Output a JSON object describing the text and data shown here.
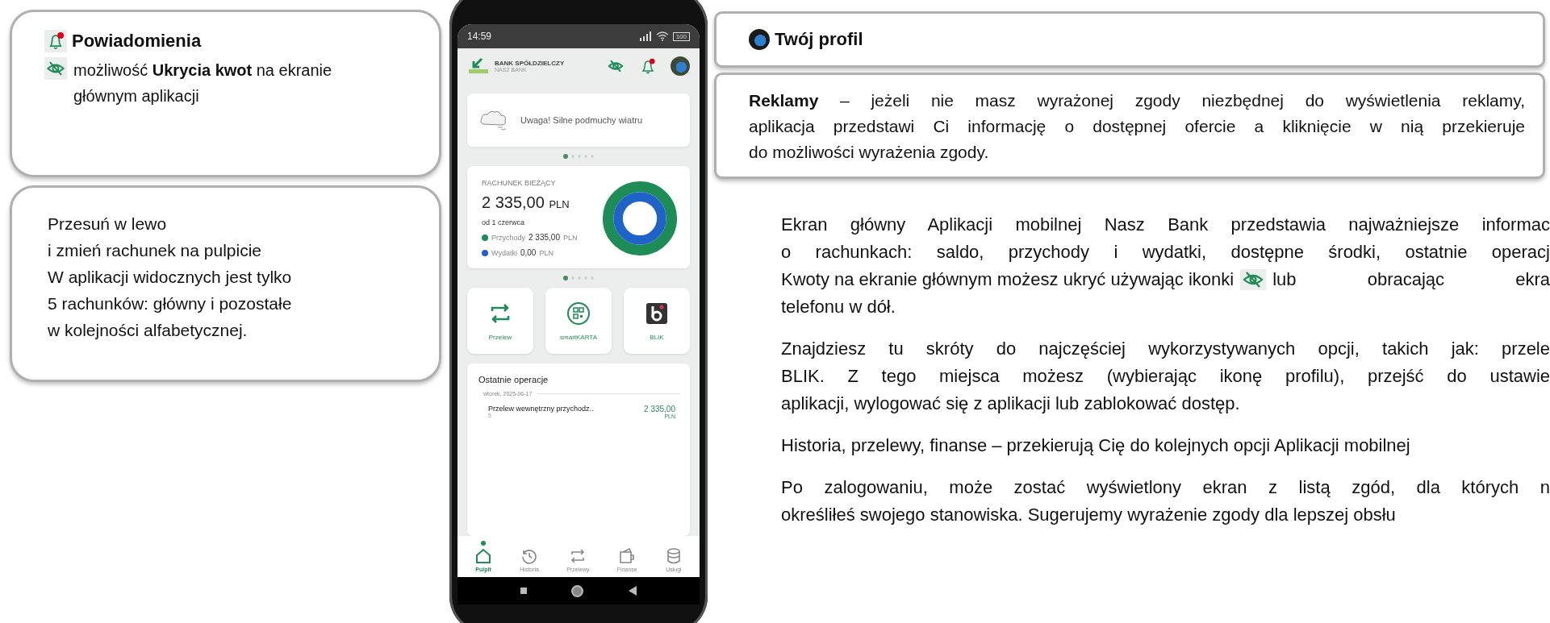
{
  "notifications_box": {
    "title": "Powiadomienia",
    "text": "możliwość **Ukrycia kwot** na ekranie głównym aplikacji"
  },
  "swipe_box": {
    "lines": [
      "Przesuń w lewo",
      "i zmień rachunek na pulpicie",
      "W aplikacji widocznych jest tylko",
      "5 rachunków: główny i pozostałe",
      "w kolejności alfabetycznej."
    ]
  },
  "phone": {
    "status_bar": {
      "time": "14:59",
      "battery": "100"
    },
    "header": {
      "bank_name": "BANK SPÓŁDZIELCZY",
      "bank_subname": "NASZ BANK"
    },
    "alert": {
      "text": "Uwaga! Silne podmuchy wiatru"
    },
    "alert_dots": [
      {
        "selected": true
      },
      {
        "selected": false
      },
      {
        "selected": false
      },
      {
        "selected": false
      },
      {
        "selected": false
      }
    ],
    "account": {
      "name": "RACHUNEK BIEŻĄCY",
      "amount": "2 335,00",
      "currency": "PLN",
      "period": "od 1 czerwca",
      "legend": [
        {
          "label": "Przychody",
          "amount": "2 335,00",
          "currency": "PLN",
          "color": "#1e8c56"
        },
        {
          "label": "Wydatki",
          "amount": "0,00",
          "currency": "PLN",
          "color": "#1f63c9"
        }
      ]
    },
    "account_dots": [
      {
        "selected": true
      },
      {
        "selected": false
      },
      {
        "selected": false
      },
      {
        "selected": false
      },
      {
        "selected": false
      }
    ],
    "shortcuts": [
      {
        "kind": "transfer",
        "label": "Przelew"
      },
      {
        "kind": "card",
        "label": "smartKARTA"
      },
      {
        "kind": "blik",
        "label": "BLIK"
      }
    ],
    "recent": {
      "title": "Ostatnie operacje",
      "date": "wtorek, 2025-06-17",
      "items": [
        {
          "title": "Przelew wewnętrzny przychodz..",
          "subtitle": "5",
          "amount": "2 335,00",
          "currency": "PLN"
        }
      ]
    },
    "tabs": [
      {
        "kind": "home",
        "label": "Pulpit",
        "selected": true
      },
      {
        "kind": "history",
        "label": "Historia",
        "selected": false
      },
      {
        "kind": "transfer",
        "label": "Przelewy",
        "selected": false
      },
      {
        "kind": "wallet",
        "label": "Finanse",
        "selected": false
      },
      {
        "kind": "services",
        "label": "Usługi",
        "selected": false
      }
    ]
  },
  "profile_box": {
    "title": "Twój profil"
  },
  "ads_box": {
    "lines": [
      "**Reklamy** – jeżeli nie masz wyrażonej zgody niezbędnej do wyświetlenia reklamy,",
      "aplikacja przedstawi Ci informację o dostępnej ofercie a kliknięcie w nią przekieruje",
      "do możliwości wyrażenia zgody."
    ]
  },
  "description": {
    "paragraphs": [
      {
        "lines": [
          {
            "kind": "text",
            "text": "Ekran główny Aplikacji mobilnej Nasz Bank przedstawia najważniejsze informac"
          },
          {
            "kind": "text",
            "text": "o rachunkach: saldo, przychody i wydatki, dostępne środki, ostatnie operacj"
          },
          {
            "kind": "icon",
            "before": "Kwoty na ekranie głównym możesz ukryć używając ikonki",
            "after": "lub obracając ekra"
          },
          {
            "kind": "text",
            "text": "telefonu w dół."
          }
        ]
      },
      {
        "lines": [
          {
            "kind": "text",
            "text": "Znajdziesz tu skróty do najczęściej wykorzystywanych opcji, takich jak: przele"
          },
          {
            "kind": "text",
            "text": "BLIK. Z tego miejsca możesz (wybierając ikonę profilu), przejść do ustawie"
          },
          {
            "kind": "text",
            "text": "aplikacji, wylogować się z aplikacji lub zablokować dostęp."
          }
        ]
      },
      {
        "lines": [
          {
            "kind": "text",
            "text": "Historia, przelewy, finanse – przekierują Cię do kolejnych opcji Aplikacji mobilnej"
          }
        ]
      },
      {
        "lines": [
          {
            "kind": "text",
            "text": "Po zalogowaniu, może zostać wyświetlony ekran z listą zgód, dla których n"
          },
          {
            "kind": "text",
            "text": "określiłeś swojego stanowiska. Sugerujemy wyrażenie zgody dla lepszej obsłu"
          }
        ]
      }
    ]
  }
}
